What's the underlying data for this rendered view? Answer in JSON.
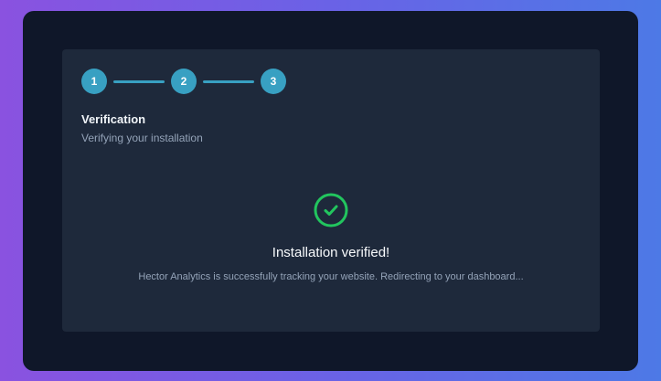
{
  "stepper": {
    "steps": [
      {
        "label": "1"
      },
      {
        "label": "2"
      },
      {
        "label": "3"
      }
    ],
    "active_color": "#38a0c2"
  },
  "section": {
    "title": "Verification",
    "subtitle": "Verifying your installation"
  },
  "result": {
    "icon": "check-circle-icon",
    "icon_color": "#22c55e",
    "title": "Installation verified!",
    "message": "Hector Analytics is successfully tracking your website. Redirecting to your dashboard..."
  }
}
